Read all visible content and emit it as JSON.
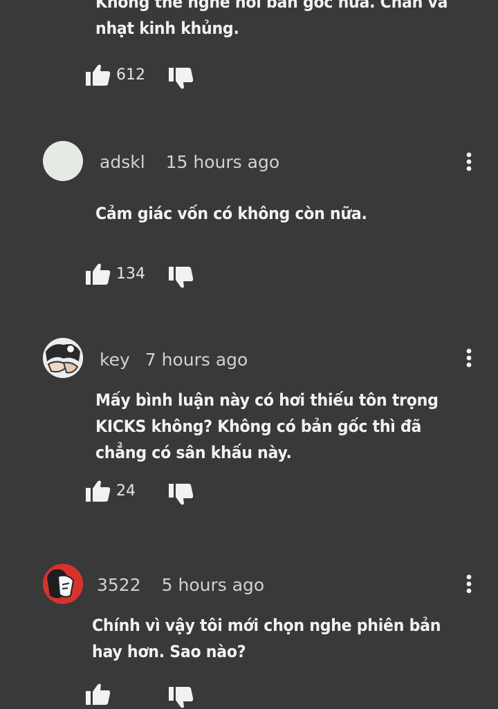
{
  "comments": [
    {
      "text": "Không thể nghe nổi bản gốc nữa. Chán và nhạt kinh khủng.",
      "likes": "612"
    },
    {
      "author": "adskl",
      "time": "15 hours ago",
      "text": "Cảm giác vốn có không còn nữa.",
      "likes": "134"
    },
    {
      "author": "key",
      "time": "7 hours ago",
      "text": "Mấy bình luận này có hơi thiếu tôn trọng KICKS không? Không có bản gốc thì đã chẳng có sân khấu này.",
      "likes": "24"
    },
    {
      "author": "3522",
      "time": "5 hours ago",
      "text": "Chính vì vậy tôi mới chọn nghe phiên bản hay hơn. Sao nào?"
    }
  ],
  "icons": {
    "like": "thumbs-up-icon",
    "dislike": "thumbs-down-icon",
    "more": "more-vertical-icon"
  },
  "colors": {
    "background": "#393939",
    "text": "#f2f2f2",
    "meta": "#d2d2d2"
  }
}
